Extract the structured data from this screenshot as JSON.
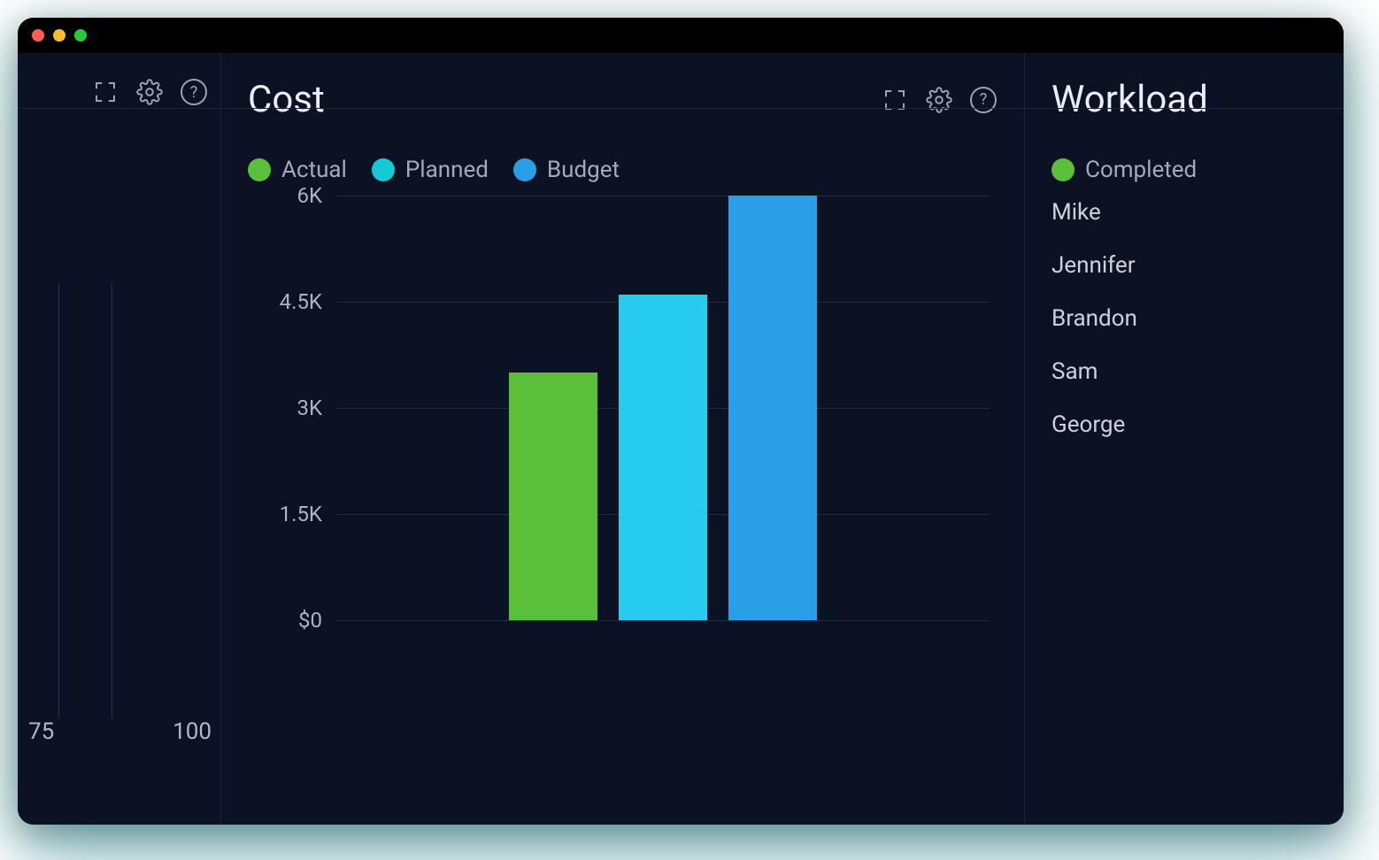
{
  "left_panel": {
    "xticks": [
      "75",
      "100"
    ]
  },
  "cost_panel": {
    "title": "Cost",
    "legend": [
      {
        "label": "Actual",
        "color": "#5bbf3b"
      },
      {
        "label": "Planned",
        "color": "#14c8d4"
      },
      {
        "label": "Budget",
        "color": "#2a9ee6"
      }
    ],
    "y_ticks": [
      "6K",
      "4.5K",
      "3K",
      "1.5K",
      "$0"
    ]
  },
  "workload_panel": {
    "title": "Workload",
    "legend": {
      "label": "Completed",
      "color": "#5bbf3b"
    },
    "names": [
      "Mike",
      "Jennifer",
      "Brandon",
      "Sam",
      "George"
    ]
  },
  "icons": {
    "expand": "expand-icon",
    "gear": "gear-icon",
    "help": "help-icon",
    "help_glyph": "?"
  },
  "chart_data": {
    "type": "bar",
    "title": "Cost",
    "categories": [
      "Actual",
      "Planned",
      "Budget"
    ],
    "values": [
      3500,
      4600,
      6000
    ],
    "series_colors": [
      "#5bbf3b",
      "#26cbee",
      "#2a9ee6"
    ],
    "xlabel": "",
    "ylabel": "",
    "ylim": [
      0,
      6000
    ],
    "y_ticks": [
      0,
      1500,
      3000,
      4500,
      6000
    ],
    "y_tick_labels": [
      "$0",
      "1.5K",
      "3K",
      "4.5K",
      "6K"
    ],
    "legend": [
      "Actual",
      "Planned",
      "Budget"
    ]
  }
}
